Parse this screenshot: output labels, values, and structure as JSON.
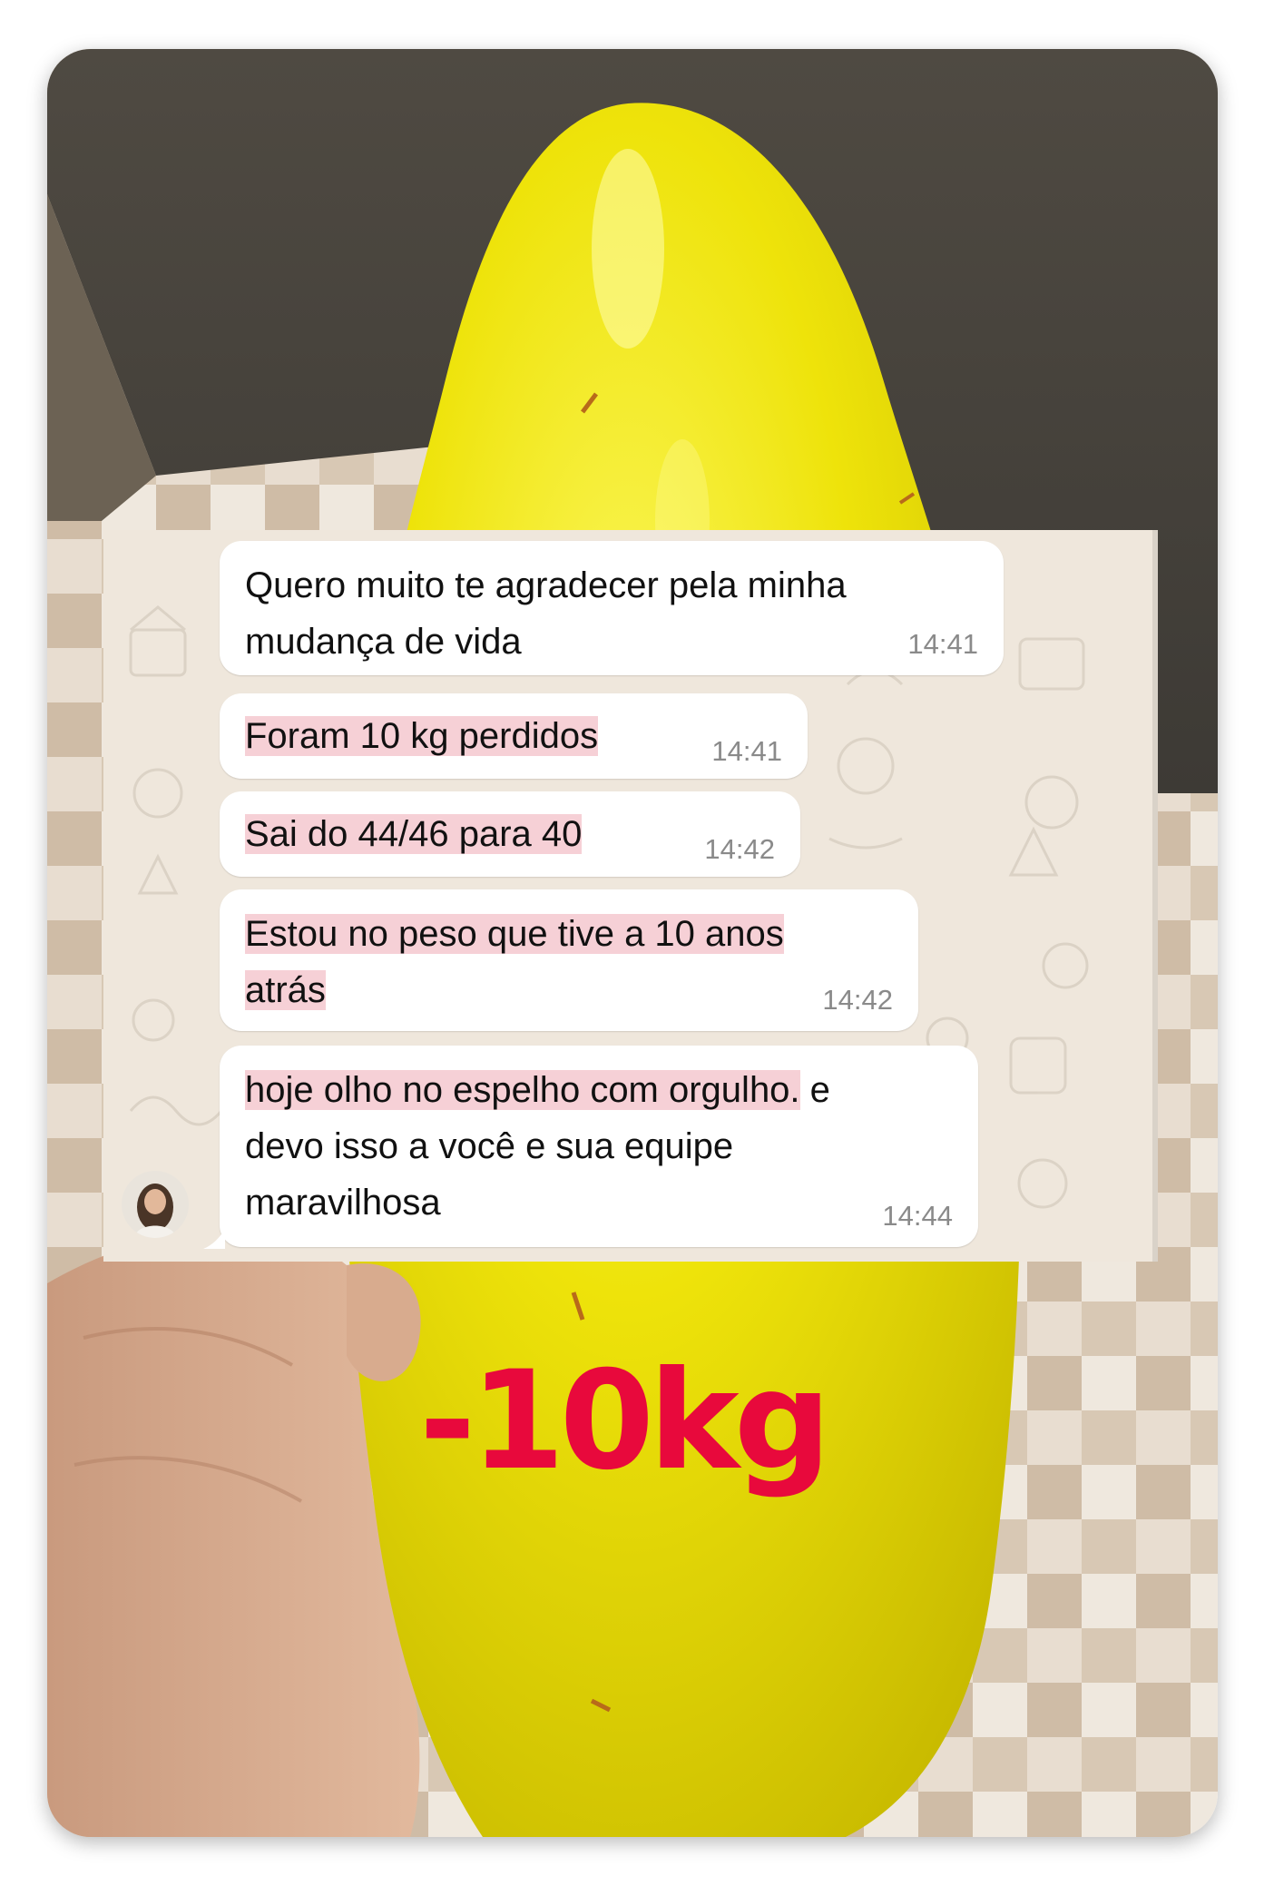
{
  "messages": [
    {
      "text_line1": "Quero muito te agradecer pela minha",
      "text_line2": "mudança de vida",
      "time": "14:41"
    },
    {
      "text": "Foram 10 kg perdidos",
      "time": "14:41"
    },
    {
      "text": "Sai do 44/46 para 40",
      "time": "14:42"
    },
    {
      "text_line1": "Estou no peso que tive a 10 anos",
      "text_line2": "atrás",
      "time": "14:42"
    },
    {
      "text_highlight": "hoje olho no espelho com orgulho.",
      "text_rest": " e",
      "text_line2": "devo isso a você e sua equipe",
      "text_line3": "maravilhosa",
      "time": "14:44"
    }
  ],
  "overlay": {
    "label": "-10kg",
    "color": "#e8093c"
  },
  "colors": {
    "fruit": "#f2ea0a",
    "chat_background": "#efe7dc",
    "highlight": "#f0c6cc"
  }
}
